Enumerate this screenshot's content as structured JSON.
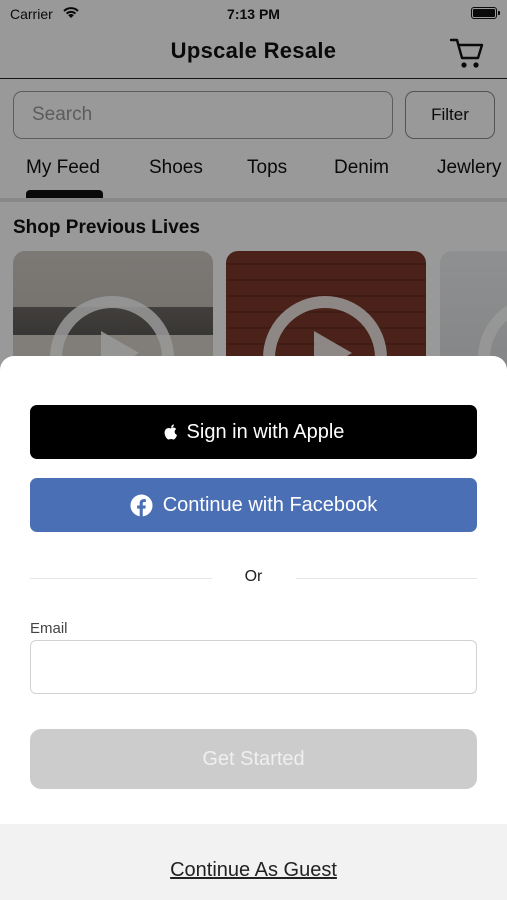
{
  "status_bar": {
    "carrier": "Carrier",
    "time": "7:13 PM"
  },
  "nav": {
    "title": "Upscale Resale",
    "cart_icon": "cart-icon"
  },
  "search": {
    "placeholder": "Search",
    "value": ""
  },
  "filter": {
    "label": "Filter"
  },
  "tabs": [
    {
      "label": "My Feed",
      "selected": true
    },
    {
      "label": "Shoes"
    },
    {
      "label": "Tops"
    },
    {
      "label": "Denim"
    },
    {
      "label": "Jewlery"
    }
  ],
  "section": {
    "title": "Shop Previous Lives"
  },
  "videos": [
    {
      "icon": "play-icon"
    },
    {
      "icon": "play-icon"
    },
    {
      "icon": "play-icon"
    }
  ],
  "sheet": {
    "apple_label": "Sign in with Apple",
    "facebook_label": "Continue with Facebook",
    "or_label": "Or",
    "email_label": "Email",
    "email_value": "",
    "get_started_label": "Get Started",
    "guest_label": "Continue As Guest"
  },
  "colors": {
    "apple_button": "#000000",
    "facebook_button": "#4a6fb5",
    "get_started_disabled": "#cccccc",
    "overlay": "rgba(0,0,0,0.4)"
  }
}
